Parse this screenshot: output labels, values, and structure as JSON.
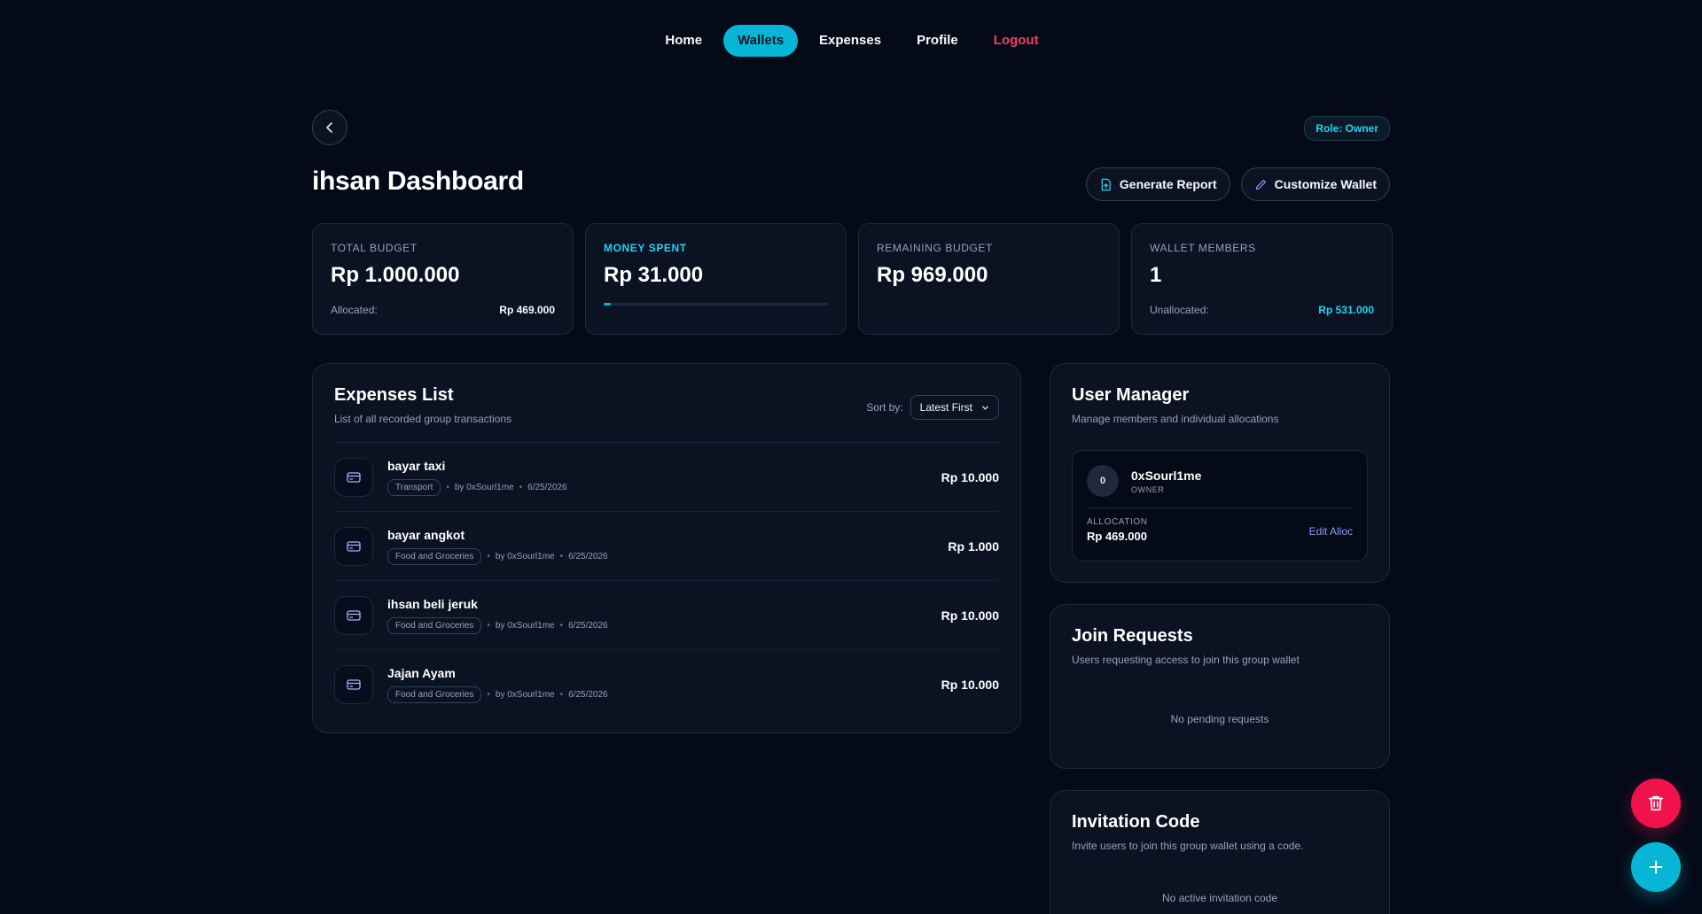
{
  "nav": {
    "items": [
      {
        "label": "Home"
      },
      {
        "label": "Wallets"
      },
      {
        "label": "Expenses"
      },
      {
        "label": "Profile"
      },
      {
        "label": "Logout"
      }
    ],
    "active": "Wallets"
  },
  "header": {
    "role_badge": "Role: Owner",
    "title": "ihsan Dashboard",
    "generate_report": "Generate Report",
    "customize_wallet": "Customize Wallet"
  },
  "stats": {
    "total_budget": {
      "label": "TOTAL BUDGET",
      "value": "Rp 1.000.000",
      "foot_label": "Allocated:",
      "foot_value": "Rp 469.000"
    },
    "money_spent": {
      "label": "MONEY SPENT",
      "value": "Rp 31.000",
      "progress_percent": 3.1
    },
    "remaining_budget": {
      "label": "REMAINING BUDGET",
      "value": "Rp 969.000"
    },
    "wallet_members": {
      "label": "WALLET MEMBERS",
      "value": "1",
      "foot_label": "Unallocated:",
      "foot_value": "Rp 531.000"
    }
  },
  "expenses": {
    "title": "Expenses List",
    "subtitle": "List of all recorded group transactions",
    "sort_label": "Sort by:",
    "sort_value": "Latest First",
    "items": [
      {
        "name": "bayar taxi",
        "category": "Transport",
        "by": "by 0xSourl1me",
        "date": "6/25/2026",
        "amount": "Rp 10.000"
      },
      {
        "name": "bayar angkot",
        "category": "Food and Groceries",
        "by": "by 0xSourl1me",
        "date": "6/25/2026",
        "amount": "Rp 1.000"
      },
      {
        "name": "ihsan beli jeruk",
        "category": "Food and Groceries",
        "by": "by 0xSourl1me",
        "date": "6/25/2026",
        "amount": "Rp 10.000"
      },
      {
        "name": "Jajan Ayam",
        "category": "Food and Groceries",
        "by": "by 0xSourl1me",
        "date": "6/25/2026",
        "amount": "Rp 10.000"
      }
    ]
  },
  "user_manager": {
    "title": "User Manager",
    "subtitle": "Manage members and individual allocations",
    "member": {
      "initial": "0",
      "name": "0xSourl1me",
      "role": "OWNER",
      "allocation_label": "ALLOCATION",
      "allocation_value": "Rp 469.000",
      "edit_label": "Edit Alloc"
    }
  },
  "join_requests": {
    "title": "Join Requests",
    "subtitle": "Users requesting access to join this group wallet",
    "empty": "No pending requests"
  },
  "invitation": {
    "title": "Invitation Code",
    "subtitle": "Invite users to join this group wallet using a code.",
    "empty": "No active invitation code"
  },
  "colors": {
    "background": "#050a18",
    "accent": "#06b6d4",
    "danger": "#f0124b",
    "logout": "#f43f5e"
  },
  "icons": [
    "chevron-left-icon",
    "report-icon",
    "pencil-icon",
    "card-icon",
    "chevron-down-icon",
    "trash-icon",
    "plus-icon"
  ]
}
